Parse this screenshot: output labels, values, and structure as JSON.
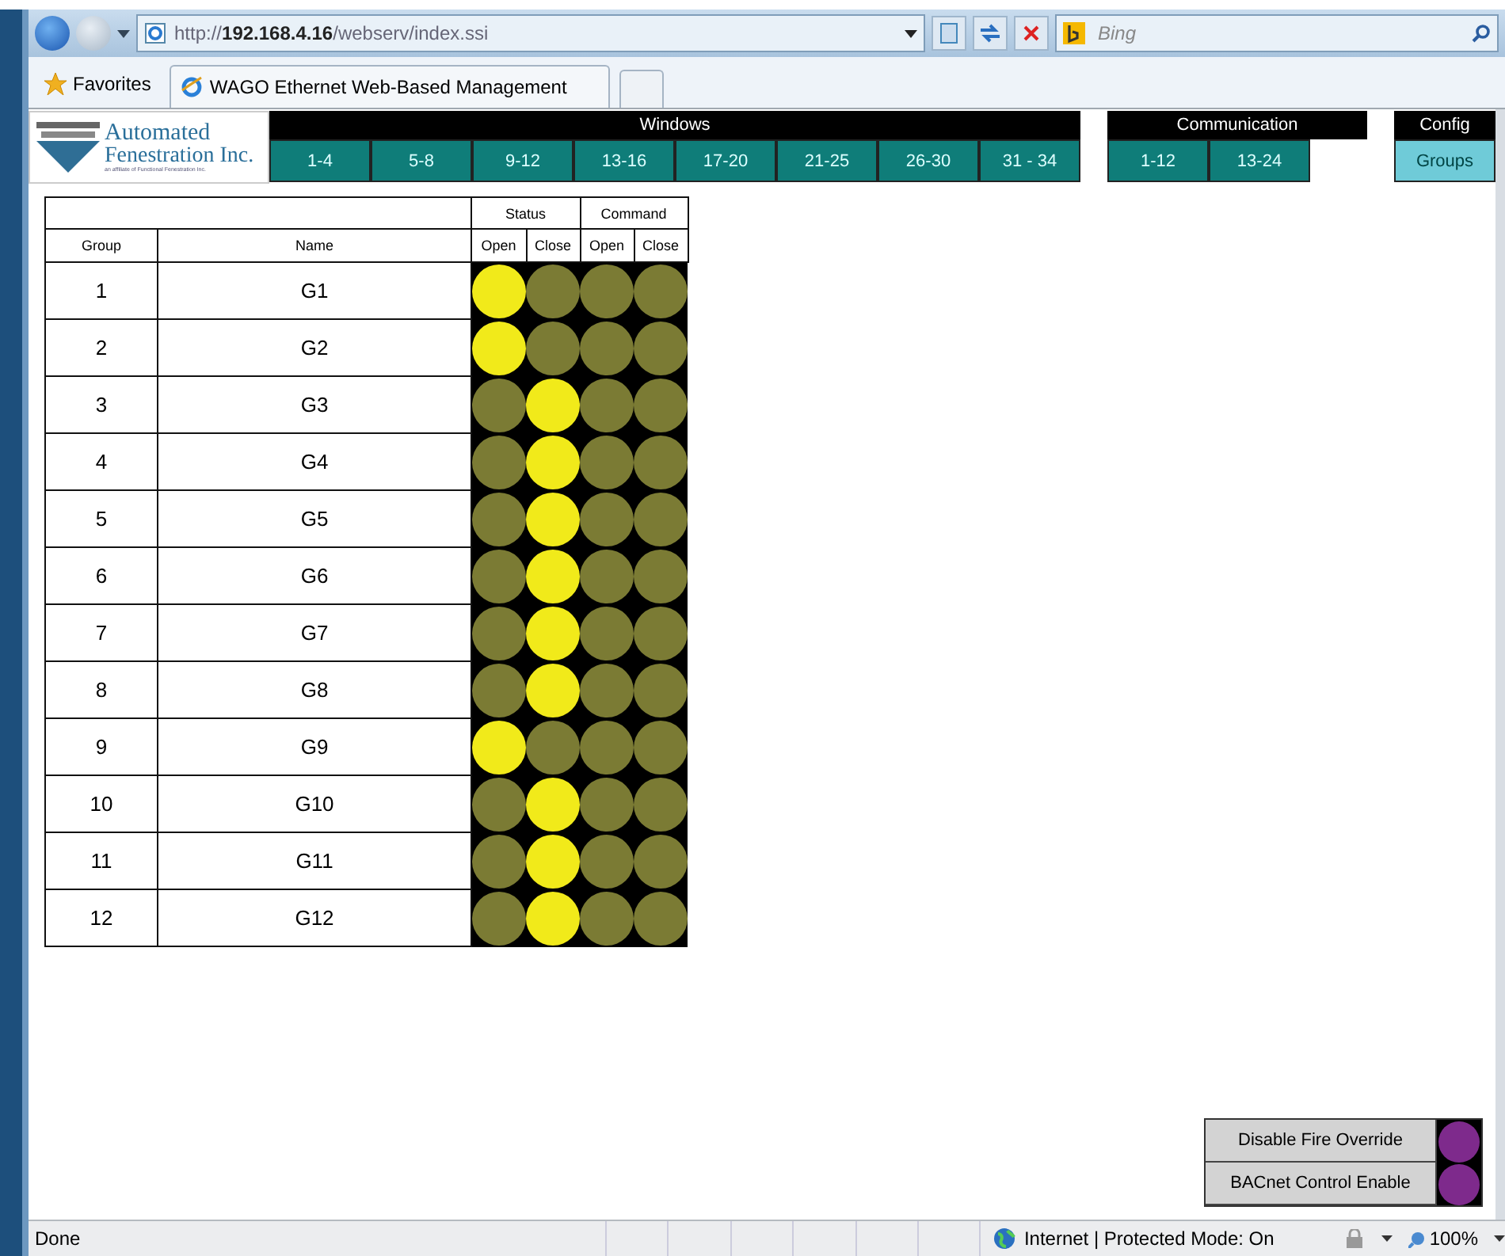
{
  "browser": {
    "address": {
      "scheme": "http://",
      "host": "192.168.4.16",
      "path": "/webserv/index.ssi"
    },
    "search": {
      "placeholder": "Bing"
    },
    "favorites": "Favorites",
    "tabs": [
      {
        "title": "WAGO Ethernet Web-Based Management",
        "selected": true
      }
    ]
  },
  "logo": {
    "line1": "Automated",
    "line2": "Fenestration Inc.",
    "tagline": "an affiliate of Functional Fenestration Inc."
  },
  "nav": [
    {
      "title": "Windows",
      "items": [
        {
          "label": "1-4",
          "selected": false
        },
        {
          "label": "5-8",
          "selected": false
        },
        {
          "label": "9-12",
          "selected": false
        },
        {
          "label": "13-16",
          "selected": false
        },
        {
          "label": "17-20",
          "selected": false
        },
        {
          "label": "21-25",
          "selected": false
        },
        {
          "label": "26-30",
          "selected": false
        },
        {
          "label": "31 - 34",
          "selected": false
        }
      ]
    },
    {
      "title": "Communication",
      "items": [
        {
          "label": "1-12",
          "selected": false
        },
        {
          "label": "13-24",
          "selected": false
        }
      ]
    },
    {
      "title": "Config",
      "items": [
        {
          "label": "Groups",
          "selected": true
        }
      ]
    }
  ],
  "table": {
    "column_groups": [
      "Status",
      "Command"
    ],
    "columns": [
      "Group",
      "Name",
      "Open",
      "Close",
      "Open",
      "Close"
    ],
    "rows": [
      {
        "group": "1",
        "name": "G1",
        "status_open": true,
        "status_close": false,
        "command_open": false,
        "command_close": false
      },
      {
        "group": "2",
        "name": "G2",
        "status_open": true,
        "status_close": false,
        "command_open": false,
        "command_close": false
      },
      {
        "group": "3",
        "name": "G3",
        "status_open": false,
        "status_close": true,
        "command_open": false,
        "command_close": false
      },
      {
        "group": "4",
        "name": "G4",
        "status_open": false,
        "status_close": true,
        "command_open": false,
        "command_close": false
      },
      {
        "group": "5",
        "name": "G5",
        "status_open": false,
        "status_close": true,
        "command_open": false,
        "command_close": false
      },
      {
        "group": "6",
        "name": "G6",
        "status_open": false,
        "status_close": true,
        "command_open": false,
        "command_close": false
      },
      {
        "group": "7",
        "name": "G7",
        "status_open": false,
        "status_close": true,
        "command_open": false,
        "command_close": false
      },
      {
        "group": "8",
        "name": "G8",
        "status_open": false,
        "status_close": true,
        "command_open": false,
        "command_close": false
      },
      {
        "group": "9",
        "name": "G9",
        "status_open": true,
        "status_close": false,
        "command_open": false,
        "command_close": false
      },
      {
        "group": "10",
        "name": "G10",
        "status_open": false,
        "status_close": true,
        "command_open": false,
        "command_close": false
      },
      {
        "group": "11",
        "name": "G11",
        "status_open": false,
        "status_close": true,
        "command_open": false,
        "command_close": false
      },
      {
        "group": "12",
        "name": "G12",
        "status_open": false,
        "status_close": true,
        "command_open": false,
        "command_close": false
      }
    ]
  },
  "overrides": [
    {
      "label": "Disable Fire Override",
      "on": true
    },
    {
      "label": "BACnet Control Enable",
      "on": true
    }
  ],
  "status_bar": {
    "text": "Done",
    "zone": "Internet | Protected Mode: On",
    "zoom": "100%"
  }
}
